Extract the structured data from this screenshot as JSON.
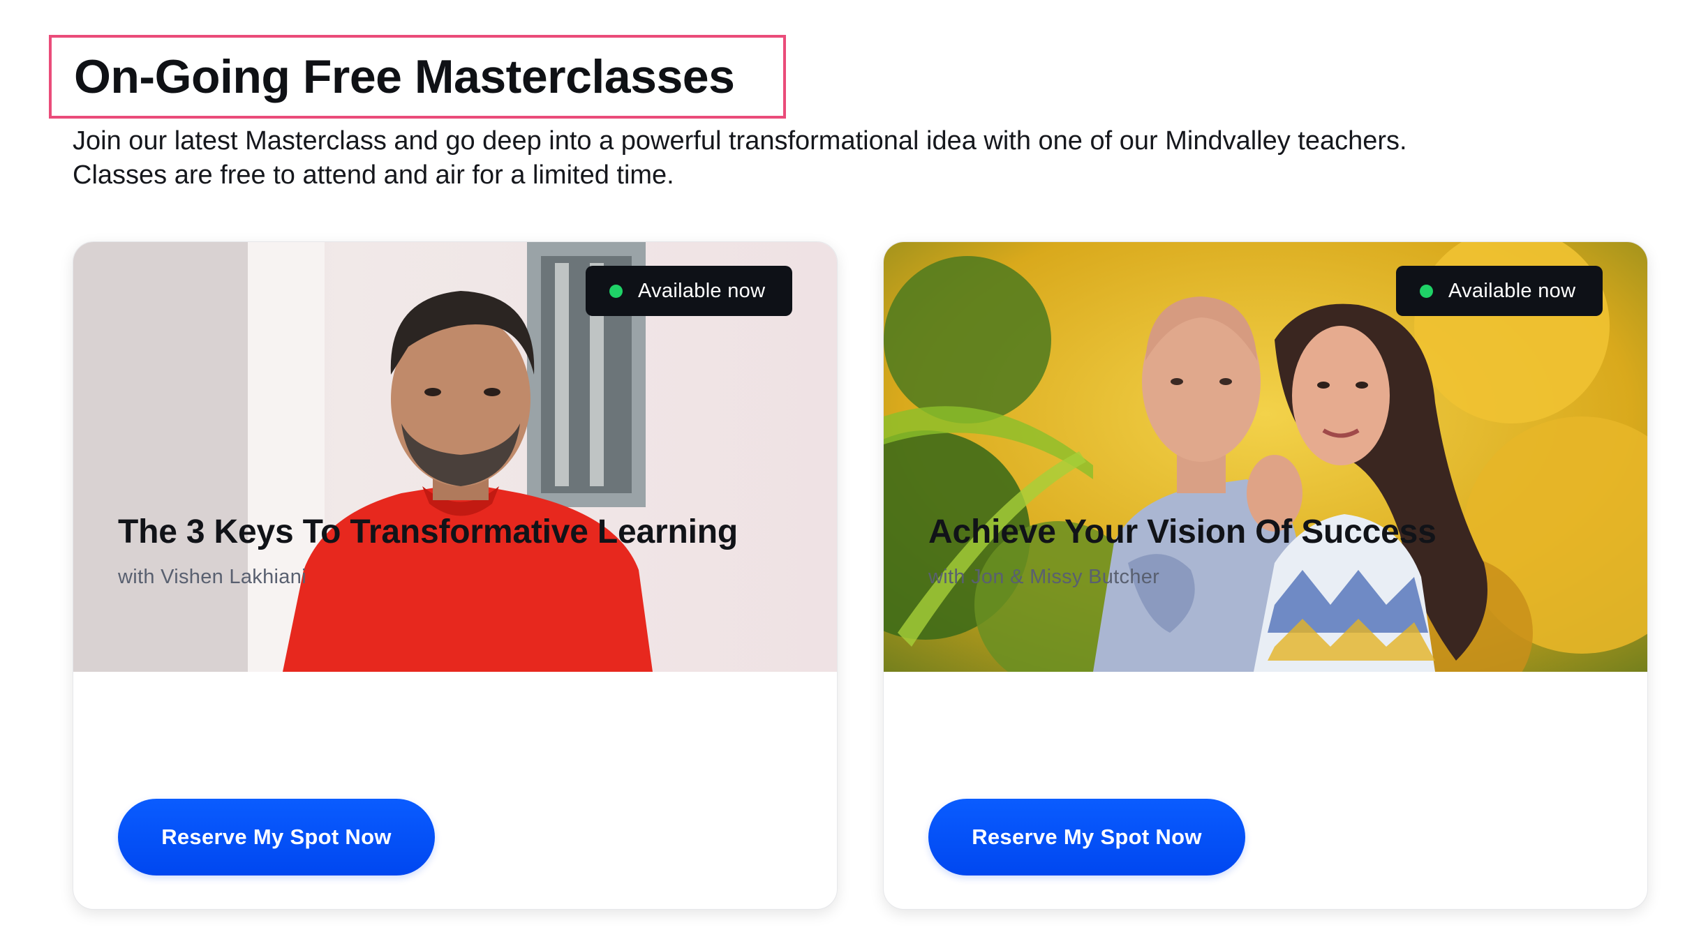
{
  "section": {
    "title": "On-Going Free Masterclasses",
    "intro_line1": "Join our latest Masterclass and go deep into a powerful transformational idea with one of our Mindvalley teachers.",
    "intro_line2": "Classes are free to attend and air for a limited time."
  },
  "cards": [
    {
      "badge": "Available now",
      "title": "The 3 Keys To Transformative Learning",
      "subtitle": "with Vishen Lakhiani",
      "cta": "Reserve My Spot Now",
      "image": "portrait-man-red-shirt"
    },
    {
      "badge": "Available now",
      "title": "Achieve Your Vision Of Success",
      "subtitle": "with Jon & Missy Butcher",
      "cta": "Reserve My Spot Now",
      "image": "portrait-couple-tropical-foliage"
    }
  ],
  "colors": {
    "highlight_border": "#ea4c7a",
    "cta_blue": "#0a5cff",
    "badge_bg": "#0e1117",
    "badge_dot": "#1fd267"
  }
}
